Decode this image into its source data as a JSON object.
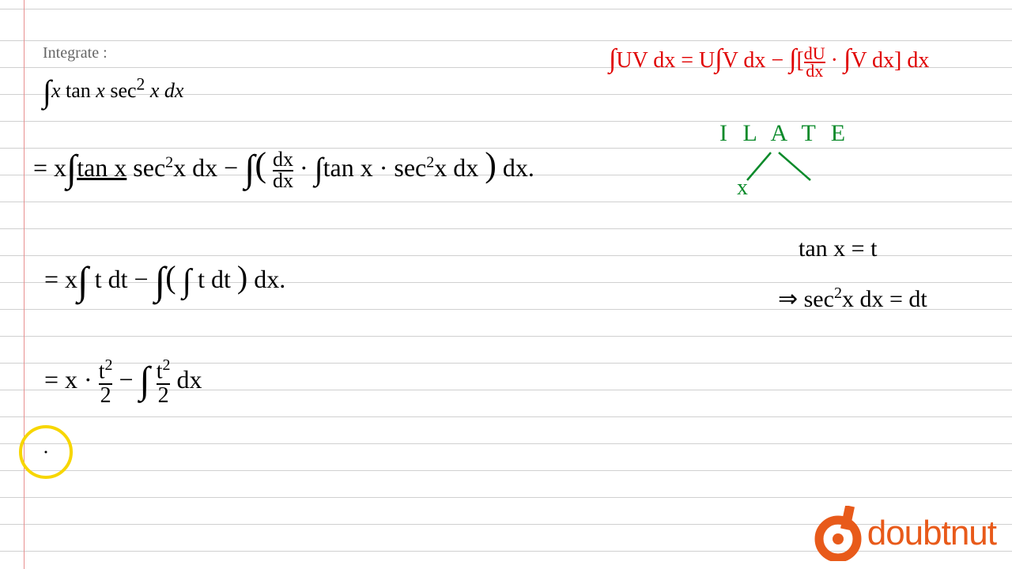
{
  "printed": {
    "heading": "Integrate :",
    "problem_html": "∫ x tan x sec² x dx"
  },
  "formula_red": "∫UV dx = U∫V dx − ∫[dU/dx · ∫V dx] dx",
  "ilate": {
    "label": "I L A T E",
    "pick": "x"
  },
  "step1": "= x ∫ tan x · sec²x dx − ∫ ( dx/dx · ∫ tan x · sec²x dx ) dx.",
  "step2": "= x ∫ t dt − ∫ ( ∫ t dt ) dx.",
  "step3": "= x · t²/2 − ∫ t²/2 dx",
  "substitution": {
    "line1": "tan x = t",
    "line2": "⇒ sec²x dx = dt"
  },
  "logo_text": "doubtnut"
}
